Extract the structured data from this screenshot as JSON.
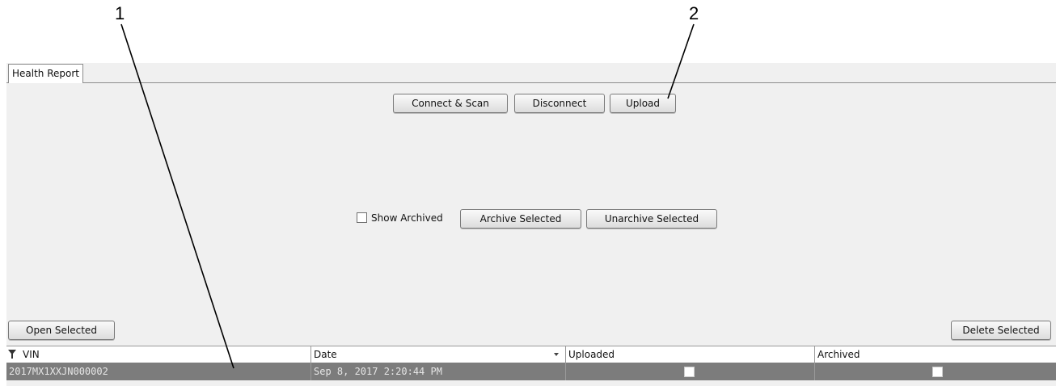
{
  "callouts": {
    "one": "1",
    "two": "2"
  },
  "tab": {
    "label": "Health Report"
  },
  "toolbar": {
    "connect_label": "Connect & Scan",
    "disconnect_label": "Disconnect",
    "upload_label": "Upload"
  },
  "archive_bar": {
    "show_archived_label": "Show Archived",
    "show_archived_checked": false,
    "archive_label": "Archive Selected",
    "unarchive_label": "Unarchive Selected"
  },
  "actions": {
    "open_label": "Open Selected",
    "delete_label": "Delete Selected"
  },
  "table": {
    "columns": [
      "VIN",
      "Date",
      "Uploaded",
      "Archived"
    ],
    "rows": [
      {
        "vin": "2017MX1XXJN000002",
        "date": "Sep 8, 2017 2:20:44 PM",
        "uploaded": false,
        "archived": false
      }
    ]
  },
  "colors": {
    "selected_row": "#7c7c7c",
    "panel_bg": "#f0f0f0"
  }
}
